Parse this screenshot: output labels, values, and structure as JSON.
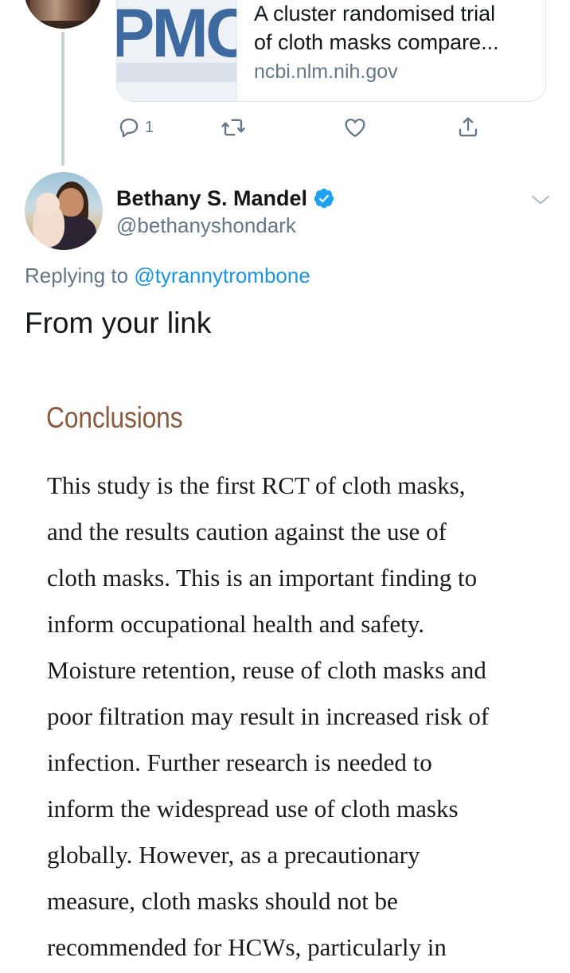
{
  "previous_tweet": {
    "link_card": {
      "thumb_text": "PMC",
      "title": "A cluster randomised trial\nof cloth masks compare...",
      "domain": "ncbi.nlm.nih.gov"
    },
    "actions": {
      "reply_count": "1"
    }
  },
  "tweet": {
    "display_name": "Bethany S. Mandel",
    "handle": "@bethanyshondark",
    "replying_prefix": "Replying to ",
    "replying_to": "@tyrannytrombone",
    "text": "From your link"
  },
  "excerpt": {
    "heading": "Conclusions",
    "lines": [
      "This study is the first RCT of cloth masks,",
      "and the results caution against the use of",
      "cloth masks. This is an important finding to",
      "inform occupational health and safety.",
      "Moisture retention, reuse of cloth masks and",
      "poor filtration may result in increased risk of",
      "infection. Further research is needed to",
      "inform the widespread use of cloth masks",
      "globally. However, as a precautionary",
      "measure, cloth masks should not be",
      "recommended for HCWs, particularly in"
    ]
  },
  "colors": {
    "link_blue": "#1b95e0",
    "secondary_text": "#657786",
    "verified_badge": "#1da1f2",
    "heading_brown": "#8a5a3f"
  },
  "icons": [
    "reply-icon",
    "retweet-icon",
    "like-icon",
    "share-icon",
    "verified-badge-icon",
    "chevron-down-icon"
  ]
}
